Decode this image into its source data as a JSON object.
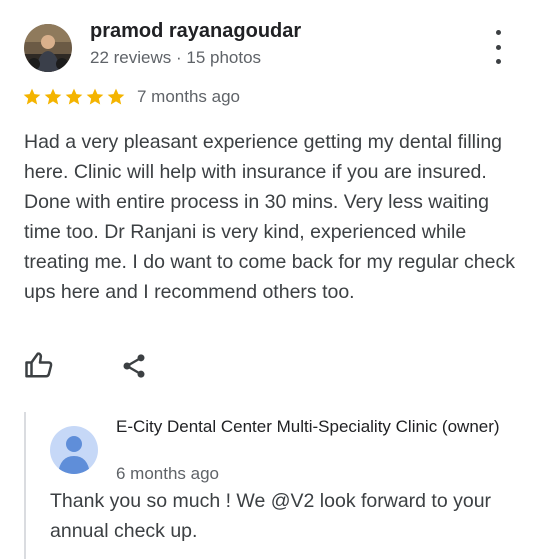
{
  "review": {
    "reviewer": {
      "name": "pramod rayanagoudar",
      "meta": "22 reviews · 15 photos"
    },
    "rating": 5,
    "date": "7 months ago",
    "text": "Had a very pleasant experience getting my dental filling here. Clinic will help with insurance if you are insured. Done with entire process in 30 mins. Very less waiting time too. Dr Ranjani is very kind, experienced while treating me. I do want to come back for my regular check ups here and I recommend others too.",
    "icons": {
      "like": "thumb-up-icon",
      "share": "share-icon",
      "more": "more-vert-icon"
    }
  },
  "owner_reply": {
    "name": "E-City Dental Center Multi-Speciality Clinic (owner)",
    "date": "6 months ago",
    "text": "Thank you so much ! We @V2 look forward to your annual check up."
  },
  "colors": {
    "star": "#f4b400",
    "text_primary": "#202124",
    "text_body": "#3c4043",
    "text_secondary": "#5f6368",
    "reply_bar": "#dadce0",
    "owner_avatar_bg": "#c6d8f7",
    "owner_avatar_fg": "#5f8ed9"
  }
}
